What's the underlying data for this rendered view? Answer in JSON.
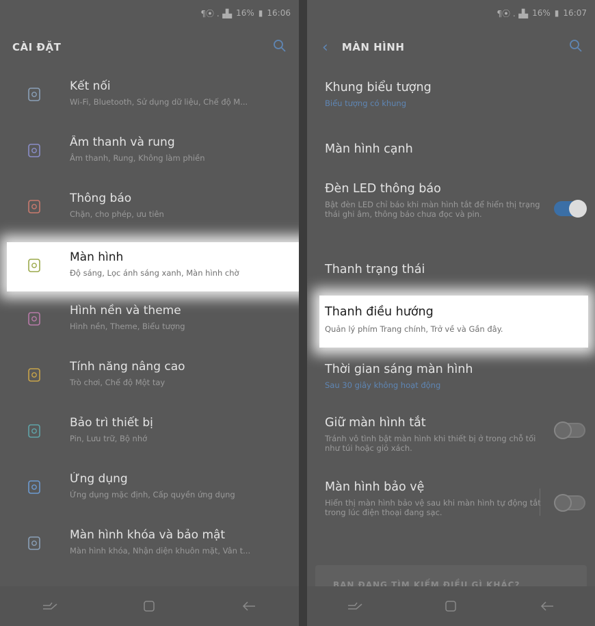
{
  "status_left": {
    "signal": "¶⦿ .▗▙",
    "battery": "16%",
    "time": "16:06"
  },
  "status_right": {
    "signal": "¶⦿ .▗▙",
    "battery": "16%",
    "time": "16:07"
  },
  "left": {
    "title": "CÀI ĐẶT",
    "items": [
      {
        "title": "Kết nối",
        "subtitle": "Wi-Fi, Bluetooth, Sử dụng dữ liệu, Chế độ M...",
        "icon": "connection-icon",
        "color": "#8aa0b8"
      },
      {
        "title": "Âm thanh và rung",
        "subtitle": "Âm thanh, Rung, Không làm phiền",
        "icon": "sound-icon",
        "color": "#8a8ec8"
      },
      {
        "title": "Thông báo",
        "subtitle": "Chặn, cho phép, ưu tiên",
        "icon": "notification-icon",
        "color": "#c87a6e"
      },
      {
        "title": "Màn hình",
        "subtitle": "Độ sáng, Lọc ánh sáng xanh, Màn hình chờ",
        "icon": "display-icon",
        "color": "#9aa84a"
      },
      {
        "title": "Hình nền và theme",
        "subtitle": "Hình nền, Theme, Biểu tượng",
        "icon": "wallpaper-icon",
        "color": "#b87aa8"
      },
      {
        "title": "Tính năng nâng cao",
        "subtitle": "Trò chơi, Chế độ Một tay",
        "icon": "advanced-features-icon",
        "color": "#c8a44a"
      },
      {
        "title": "Bảo trì thiết bị",
        "subtitle": "Pin, Lưu trữ, Bộ nhớ",
        "icon": "device-care-icon",
        "color": "#5fa4a8"
      },
      {
        "title": "Ứng dụng",
        "subtitle": "Ứng dụng mặc định, Cấp quyền ứng dụng",
        "icon": "apps-icon",
        "color": "#6c9ad0"
      },
      {
        "title": "Màn hình khóa và bảo mật",
        "subtitle": "Màn hình khóa, Nhận diện khuôn mặt, Vân t...",
        "icon": "lock-icon",
        "color": "#8aa0b8"
      }
    ]
  },
  "right": {
    "title": "MÀN HÌNH",
    "items": [
      {
        "title": "Khung biểu tượng",
        "subtitle": "Biểu tượng có khung"
      },
      {
        "title": "Màn hình cạnh",
        "subtitle": ""
      },
      {
        "title": "Đèn LED thông báo",
        "subtitle": "Bật đèn LED chỉ báo khi màn hình tắt để hiển thị trạng thái ghi âm, thông báo chưa đọc và pin.",
        "toggle": true
      },
      {
        "title": "Thanh trạng thái",
        "subtitle": ""
      },
      {
        "title": "Thanh điều hướng",
        "subtitle": "Quản lý phím Trang chính, Trở về và Gần đây."
      },
      {
        "title": "Thời gian sáng màn hình",
        "subtitle": "Sau 30 giây không hoạt động"
      },
      {
        "title": "Giữ màn hình tắt",
        "subtitle": "Tránh vô tình bật màn hình khi thiết bị ở trong chỗ tối như túi hoặc giỏ xách.",
        "toggle": false
      },
      {
        "title": "Màn hình bảo vệ",
        "subtitle": "Hiển thị màn hình bảo vệ sau khi màn hình tự động tắt trong lúc điện thoại đang sạc.",
        "toggle": false
      }
    ],
    "card_title": "BẠN ĐANG TÌM KIẾM ĐIỀU GÌ KHÁC?"
  },
  "colors": {
    "accent": "#5f86b4",
    "highlight": "#ffffff",
    "toggle_on": "#3b6fa6"
  }
}
